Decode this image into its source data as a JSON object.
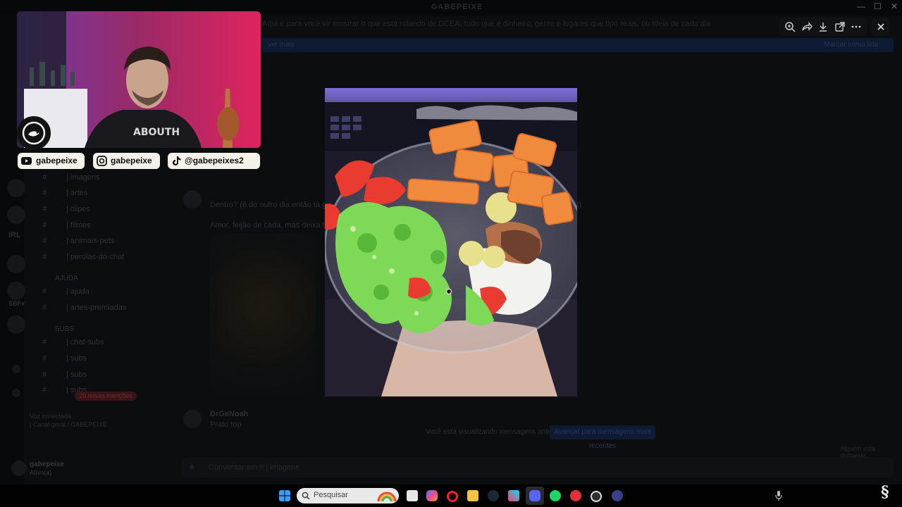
{
  "app": {
    "title": "GABEPEIXE",
    "topic": "Aqui é para você vir mostrar o que está rolando de DCEA, tudo que é dinheiro, gente e lugares que tipo reais, ou ideia de cada dia que tenha do DCEA",
    "banner_left": "ver mais",
    "banner_right": "Marcar como lida"
  },
  "window_controls": {
    "minimize": "—",
    "maximize": "☐",
    "close": "✕"
  },
  "channels": [
    {
      "icon": "#",
      "name": "| imagens",
      "extra": ""
    },
    {
      "icon": "#",
      "name": "| artes",
      "extra": ""
    },
    {
      "icon": "#",
      "name": "| clipes",
      "extra": ""
    },
    {
      "icon": "#",
      "name": "| filmes",
      "extra": ""
    },
    {
      "icon": "#",
      "name": "| animais-pets",
      "extra": ""
    },
    {
      "icon": "#",
      "name": "| perolas-do-chat",
      "extra": ""
    }
  ],
  "channel_groups": [
    {
      "category": "AJUDA",
      "items": [
        "| ajuda",
        "| artes-premiadas"
      ]
    },
    {
      "category": "SUBS",
      "items": [
        "| chat-subs",
        "| subs",
        "| subs",
        "| subs"
      ]
    }
  ],
  "rail_labels": {
    "irl": "IRL",
    "sub": "SBFx"
  },
  "new_mentions_badge": "20 novas menções",
  "voice_panel": {
    "status": "Voz conectada",
    "channel": "| Canal geral / GABEPEIXE"
  },
  "user_panel": {
    "name": "gabepeixe",
    "status": "Ativo(a)"
  },
  "messages": [
    {
      "author": "",
      "text": "Dentro? (é do outro dia então tá gu... ... para o react ja pode ter visto fica olhando ... nada do tudo pra react)"
    },
    {
      "author": "",
      "text": "Amor, feijão de cada, mas deixa tá..."
    },
    {
      "author": "DrGeNoah",
      "text": "Prato top"
    }
  ],
  "older_bar": {
    "text": "Você está visualizando mensagens antigas",
    "button": "Avançar para mensagens mais recentes"
  },
  "typing_text": "Alguém está digitando...",
  "composer": {
    "plus": "+",
    "placeholder": "Conversar em # | imagens"
  },
  "viewer": {
    "tools": [
      "zoom-in-icon",
      "forward-icon",
      "download-icon",
      "open-external-icon",
      "more-icon"
    ],
    "close": "✕"
  },
  "socials": [
    {
      "platform": "youtube",
      "handle": "gabepeixe"
    },
    {
      "platform": "instagram",
      "handle": "gabepeixe"
    },
    {
      "platform": "tiktok",
      "handle": "@gabepeixes2"
    }
  ],
  "taskbar": {
    "search_placeholder": "Pesquisar",
    "apps": [
      "windows-start-icon",
      "task-view-icon",
      "copilot-icon",
      "opera-icon",
      "file-explorer-icon",
      "steam-icon",
      "capcut-icon",
      "discord-icon",
      "spotify-icon",
      "app-red-icon",
      "obs-icon",
      "app-arrow-icon"
    ]
  },
  "colors": {
    "discord_blue": "#5865f2",
    "overlay_pill": "#f4f1ea",
    "webcam_accent": "#e0245e"
  }
}
